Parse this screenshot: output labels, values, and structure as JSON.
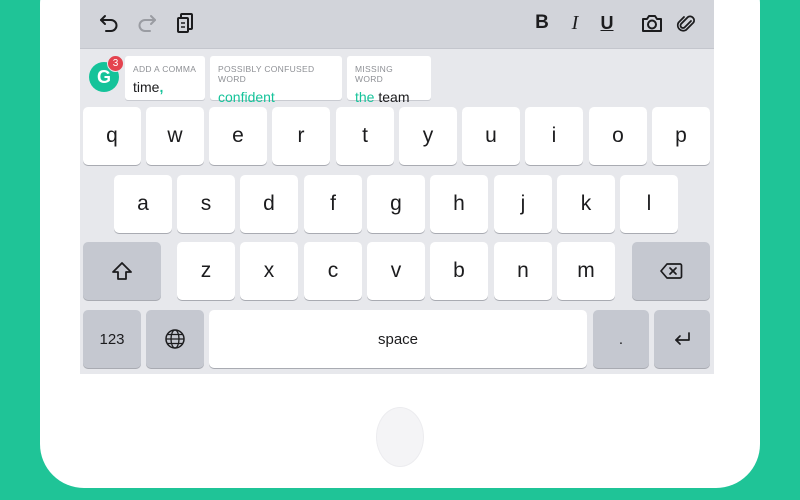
{
  "toolbar": {
    "undo_icon": "undo-icon",
    "redo_icon": "redo-icon",
    "clipboard_icon": "clipboard-icon",
    "bold_label": "B",
    "italic_label": "I",
    "underline_label": "U",
    "camera_icon": "camera-icon",
    "attachment_icon": "paperclip-icon"
  },
  "suggestions": {
    "badge_count": "3",
    "logo_letter": "G",
    "items": [
      {
        "label": "ADD A COMMA",
        "text": "time",
        "accent": ","
      },
      {
        "label": "POSSIBLY CONFUSED WORD",
        "text": "confident"
      },
      {
        "label": "MISSING WORD",
        "accent": "the",
        "text": " team"
      }
    ]
  },
  "keyboard": {
    "row1": [
      "q",
      "w",
      "e",
      "r",
      "t",
      "y",
      "u",
      "i",
      "o",
      "p"
    ],
    "row2": [
      "a",
      "s",
      "d",
      "f",
      "g",
      "h",
      "j",
      "k",
      "l"
    ],
    "row3": [
      "z",
      "x",
      "c",
      "v",
      "b",
      "n",
      "m"
    ],
    "numbers_label": "123",
    "space_label": "space",
    "period_label": ".",
    "shift_icon": "shift-arrow-icon",
    "backspace_icon": "backspace-icon",
    "globe_icon": "globe-icon",
    "return_icon": "return-arrow-icon"
  },
  "colors": {
    "background": "#1fc497",
    "accent": "#15c39a",
    "badge": "#e4434f"
  }
}
